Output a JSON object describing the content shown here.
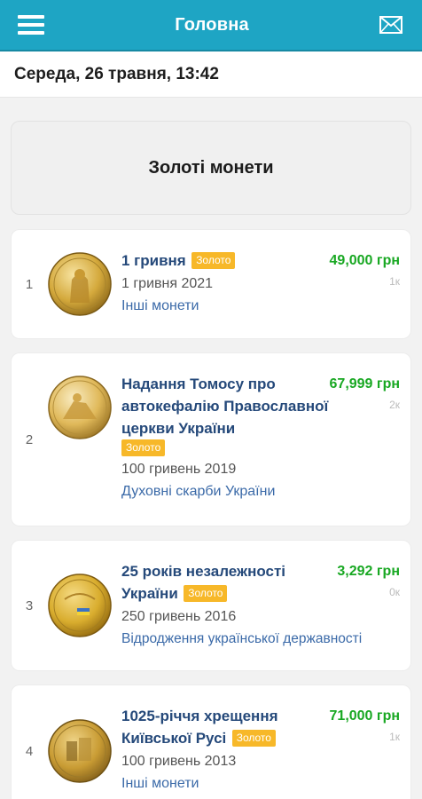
{
  "appbar": {
    "title": "Головна",
    "menu_icon": "hamburger-icon",
    "mail_icon": "mail-icon"
  },
  "datebar": {
    "text": "Середа, 26 травня, 13:42"
  },
  "section": {
    "title": "Золоті монети"
  },
  "colors": {
    "appbar": "#1ea5c4",
    "price": "#19a823",
    "badge": "#f7b829",
    "link": "#25497a"
  },
  "coins": [
    {
      "index": "1",
      "title": "1 гривня",
      "badge": "Золото",
      "nominal": "1 гривня 2021",
      "series": "Інші монети",
      "price": "49,000 грн",
      "views": "1к"
    },
    {
      "index": "2",
      "title": "Надання Томосу про автокефалію Православної церкви України",
      "badge": "Золото",
      "nominal": "100 гривень 2019",
      "series": "Духовні скарби України",
      "price": "67,999 грн",
      "views": "2к"
    },
    {
      "index": "3",
      "title": "25 років незалежності України",
      "badge": "Золото",
      "nominal": "250 гривень 2016",
      "series": "Відродження української державності",
      "price": "3,292 грн",
      "views": "0к"
    },
    {
      "index": "4",
      "title": "1025-річчя хрещення Київської Русі",
      "badge": "Золото",
      "nominal": "100 гривень 2013",
      "series": "Інші монети",
      "price": "71,000 грн",
      "views": "1к"
    }
  ]
}
